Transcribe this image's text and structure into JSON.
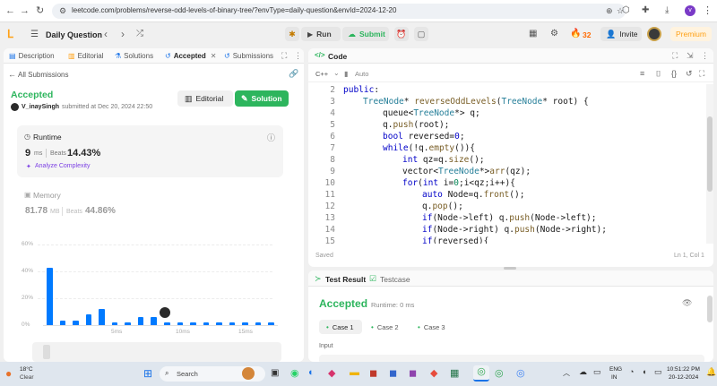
{
  "browser": {
    "url": "leetcode.com/problems/reverse-odd-levels-of-binary-tree/?envType=daily-question&envId=2024-12-20",
    "profile_initial": "v"
  },
  "toolbar": {
    "problem_list_label": "Daily Question",
    "run_label": "Run",
    "submit_label": "Submit",
    "streak_count": "32",
    "invite_label": "Invite",
    "premium_label": "Premium"
  },
  "left_tabs": [
    {
      "label": "Description"
    },
    {
      "label": "Editorial"
    },
    {
      "label": "Solutions"
    },
    {
      "label": "Accepted"
    },
    {
      "label": "Submissions"
    }
  ],
  "submission": {
    "back_label": "All Submissions",
    "status": "Accepted",
    "user": "V_inaySingh",
    "submitted_text": "submitted at Dec 20, 2024 22:50",
    "editorial_btn": "Editorial",
    "solution_btn": "Solution",
    "runtime_title": "Runtime",
    "runtime_value": "9",
    "runtime_unit": "ms",
    "beats_label": "Beats",
    "runtime_beats": "14.43%",
    "analyze_label": "Analyze Complexity",
    "memory_title": "Memory",
    "memory_value": "81.78",
    "memory_unit": "MB",
    "memory_beats": "44.86%"
  },
  "chart_data": {
    "type": "bar",
    "ylabels": [
      "60%",
      "40%",
      "20%",
      "0%"
    ],
    "ylim": [
      0,
      60
    ],
    "xlabels": [
      "5ms",
      "10ms",
      "15ms"
    ],
    "values": [
      42,
      3,
      3,
      8,
      12,
      2,
      2,
      6,
      6,
      2,
      2,
      2,
      2,
      2,
      2,
      2,
      2,
      2
    ],
    "accent": "#007aff"
  },
  "code": {
    "title": "Code",
    "language": "C++",
    "mode": "Auto",
    "saved_label": "Saved",
    "cursor_pos": "Ln 1, Col 1",
    "lines": [
      {
        "n": "2",
        "indent": 0,
        "html": "<span class=\"kw\">public</span><span class=\"pl\">:</span>"
      },
      {
        "n": "3",
        "indent": 1,
        "html": "<span class=\"ty\">TreeNode</span><span class=\"pl\">* </span><span class=\"fn\">reverseOddLevels</span><span class=\"pl\">(</span><span class=\"ty\">TreeNode</span><span class=\"pl\">* root) {</span>"
      },
      {
        "n": "4",
        "indent": 2,
        "html": "<span class=\"pl\">queue&lt;</span><span class=\"ty\">TreeNode</span><span class=\"pl\">*&gt; q;</span>"
      },
      {
        "n": "5",
        "indent": 2,
        "html": "<span class=\"pl\">q.</span><span class=\"fn\">push</span><span class=\"pl\">(root);</span>"
      },
      {
        "n": "6",
        "indent": 2,
        "html": "<span class=\"kw\">bool</span><span class=\"pl\"> reversed=</span><span class=\"kw\">0</span><span class=\"pl\">;</span>"
      },
      {
        "n": "7",
        "indent": 2,
        "html": "<span class=\"kw\">while</span><span class=\"pl\">(!q.</span><span class=\"fn\">empty</span><span class=\"pl\">()){</span>"
      },
      {
        "n": "8",
        "indent": 3,
        "html": "<span class=\"kw\">int</span><span class=\"pl\"> qz=q.</span><span class=\"fn\">size</span><span class=\"pl\">();</span>"
      },
      {
        "n": "9",
        "indent": 3,
        "html": "<span class=\"pl\">vector&lt;</span><span class=\"ty\">TreeNode</span><span class=\"pl\">*&gt;</span><span class=\"fn\">arr</span><span class=\"pl\">(qz);</span>"
      },
      {
        "n": "10",
        "indent": 3,
        "html": "<span class=\"kw\">for</span><span class=\"pl\">(</span><span class=\"kw\">int</span><span class=\"pl\"> i=</span><span class=\"nm\">0</span><span class=\"pl\">;i&lt;qz;i++){</span>"
      },
      {
        "n": "11",
        "indent": 4,
        "html": "<span class=\"kw\">auto</span><span class=\"pl\"> Node=q.</span><span class=\"fn\">front</span><span class=\"pl\">();</span>"
      },
      {
        "n": "12",
        "indent": 4,
        "html": "<span class=\"pl\">q.</span><span class=\"fn\">pop</span><span class=\"pl\">();</span>"
      },
      {
        "n": "13",
        "indent": 4,
        "html": "<span class=\"kw\">if</span><span class=\"pl\">(Node-&gt;left) q.</span><span class=\"fn\">push</span><span class=\"pl\">(Node-&gt;left);</span>"
      },
      {
        "n": "14",
        "indent": 4,
        "html": "<span class=\"kw\">if</span><span class=\"pl\">(Node-&gt;right) q.</span><span class=\"fn\">push</span><span class=\"pl\">(Node-&gt;right);</span>"
      },
      {
        "n": "15",
        "indent": 4,
        "html": "<span class=\"kw\">if</span><span class=\"pl\">(reversed){</span>"
      }
    ]
  },
  "result": {
    "tab_label": "Test Result",
    "testcase_label": "Testcase",
    "status": "Accepted",
    "runtime_text": "Runtime: 0 ms",
    "cases": [
      "Case 1",
      "Case 2",
      "Case 3"
    ],
    "input_label": "Input"
  },
  "taskbar": {
    "temp": "18°C",
    "weather": "Clear",
    "search_placeholder": "Search",
    "lang_top": "ENG",
    "lang_bottom": "IN",
    "time": "10:51:22 PM",
    "date": "20-12-2024"
  }
}
